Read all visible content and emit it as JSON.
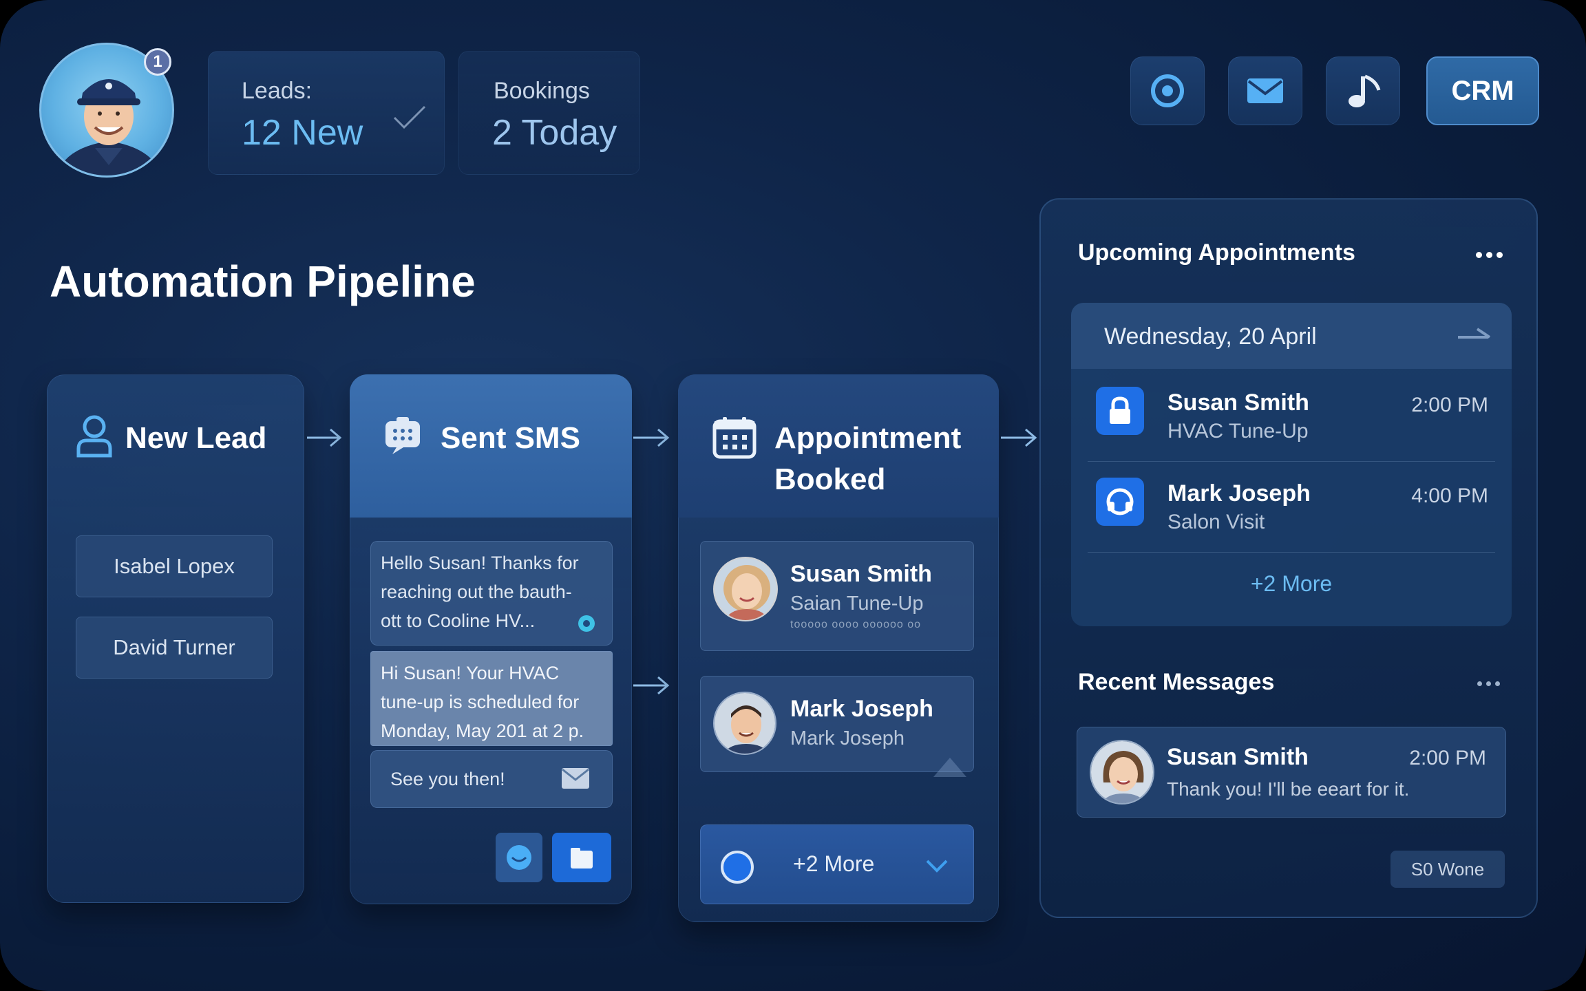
{
  "header": {
    "avatar_badge": "1",
    "leads_label": "Leads:",
    "leads_value": "12 New",
    "bookings_label": "Bookings",
    "bookings_value": "2 Today",
    "crm_label": "CRM",
    "icons": [
      "target-icon",
      "mail-icon",
      "music-note-icon"
    ]
  },
  "pipeline": {
    "title": "Automation Pipeline",
    "new_lead": {
      "title": "New Lead",
      "leads": [
        "Isabel Lopex",
        "David Turner"
      ]
    },
    "sent_sms": {
      "title": "Sent SMS",
      "message_1": [
        "Hello Susan! Thanks for",
        "reaching out the bauth-",
        "ott to Cooline HV..."
      ],
      "message_2": [
        "Hi Susan! Your HVAC",
        "tune-up is scheduled for",
        "Monday, May 201 at 2 p."
      ],
      "message_3": "See you then!"
    },
    "appointment_booked": {
      "title_line1": "Appointment",
      "title_line2": "Booked",
      "cards": [
        {
          "name": "Susan Smith",
          "sub": "Saian Tune-Up",
          "extra": "tooooo oooo oooooo oo"
        },
        {
          "name": "Mark Joseph",
          "sub": "Mark Joseph"
        }
      ],
      "more": "+2 More"
    }
  },
  "upcoming": {
    "title": "Upcoming Appointments",
    "date": "Wednesday, 20 April",
    "items": [
      {
        "name": "Susan Smith",
        "service": "HVAC Tune-Up",
        "time": "2:00 PM",
        "icon": "lock-icon"
      },
      {
        "name": "Mark Joseph",
        "service": "Salon Visit",
        "time": "4:00 PM",
        "icon": "headset-icon"
      }
    ],
    "more": "+2 More"
  },
  "recent": {
    "title": "Recent Messages",
    "items": [
      {
        "name": "Susan Smith",
        "time": "2:00 PM",
        "text": "Thank you! I'll be eeart for it."
      }
    ],
    "footer": "S0 Wone"
  },
  "colors": {
    "accent": "#6cbcf2",
    "primary_blue": "#1f6fe6",
    "background": "#0f2549"
  }
}
